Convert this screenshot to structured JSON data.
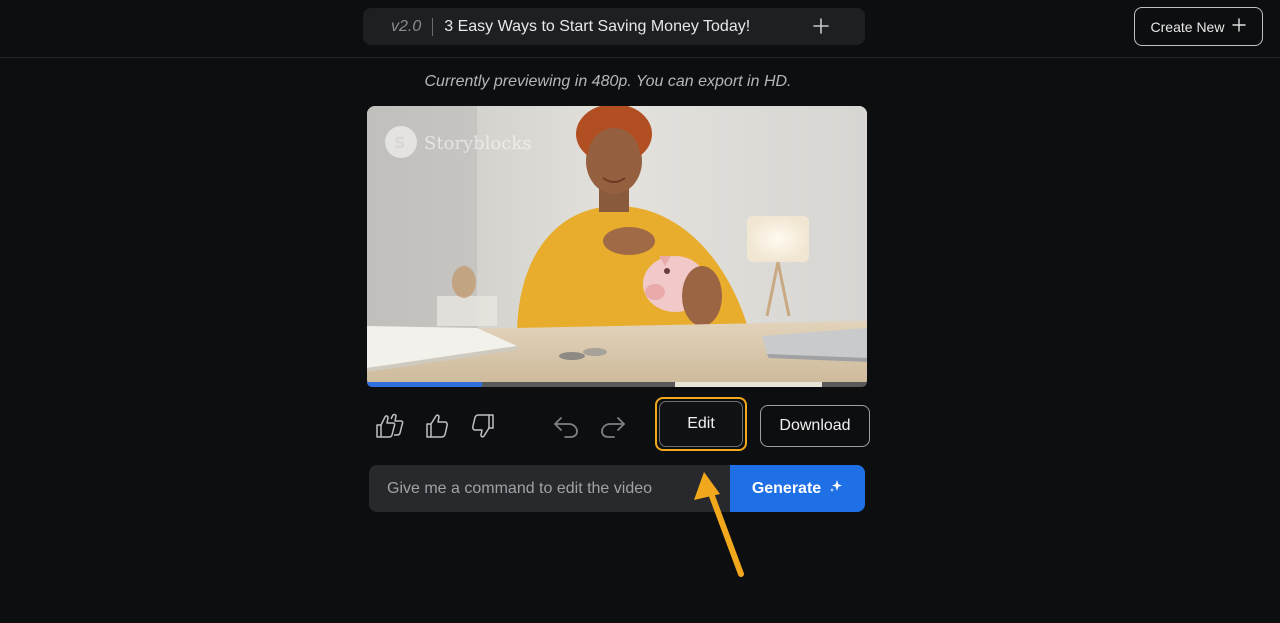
{
  "header": {
    "version": "v2.0",
    "title": "3 Easy Ways to Start Saving Money Today!",
    "create_new_label": "Create New"
  },
  "preview": {
    "note": "Currently previewing in 480p. You can export in HD.",
    "watermark": "Storyblocks",
    "progress_fraction": 0.23,
    "buffered_start_fraction": 0.615,
    "buffered_end_fraction": 0.91
  },
  "actions": {
    "edit_label": "Edit",
    "download_label": "Download",
    "icons": [
      "double-thumbs-up-icon",
      "thumbs-up-icon",
      "thumbs-down-icon",
      "undo-icon",
      "redo-icon"
    ]
  },
  "command": {
    "placeholder": "Give me a command to edit the video",
    "value": "",
    "generate_label": "Generate"
  },
  "colors": {
    "background": "#0d0e10",
    "accent_blue": "#1f6fe6",
    "highlight_orange": "#f2a81d"
  }
}
